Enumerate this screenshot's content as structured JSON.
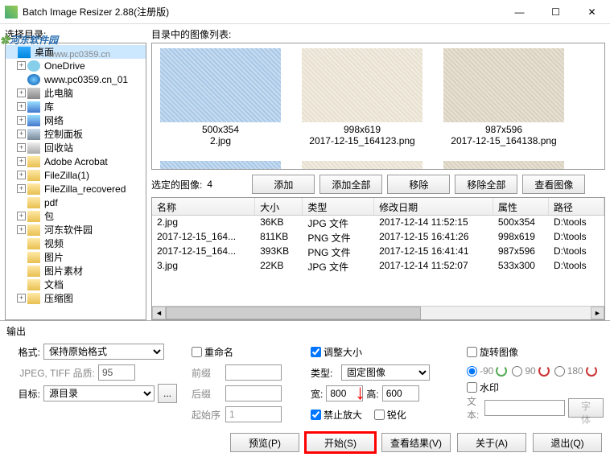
{
  "window": {
    "title": "Batch Image Resizer 2.88(注册版)",
    "min": "—",
    "max": "☐",
    "close": "✕"
  },
  "watermark": {
    "brand": "河东软件园",
    "url": "www.pc0359.cn"
  },
  "tree": {
    "label": "选择目录:",
    "items": [
      {
        "depth": 0,
        "exp": "",
        "ico": "desktop",
        "text": "桌面",
        "sel": true
      },
      {
        "depth": 1,
        "exp": "+",
        "ico": "cloud",
        "text": "OneDrive"
      },
      {
        "depth": 1,
        "exp": "",
        "ico": "globe",
        "text": "www.pc0359.cn_01"
      },
      {
        "depth": 1,
        "exp": "+",
        "ico": "pc",
        "text": "此电脑"
      },
      {
        "depth": 1,
        "exp": "+",
        "ico": "lib",
        "text": "库"
      },
      {
        "depth": 1,
        "exp": "+",
        "ico": "net",
        "text": "网络"
      },
      {
        "depth": 1,
        "exp": "+",
        "ico": "panel",
        "text": "控制面板"
      },
      {
        "depth": 1,
        "exp": "+",
        "ico": "trash",
        "text": "回收站"
      },
      {
        "depth": 1,
        "exp": "+",
        "ico": "folder",
        "text": "Adobe Acrobat"
      },
      {
        "depth": 1,
        "exp": "+",
        "ico": "folder",
        "text": "FileZilla(1)"
      },
      {
        "depth": 1,
        "exp": "+",
        "ico": "folder",
        "text": "FileZilla_recovered"
      },
      {
        "depth": 1,
        "exp": "",
        "ico": "folder",
        "text": "pdf"
      },
      {
        "depth": 1,
        "exp": "+",
        "ico": "folder",
        "text": "包"
      },
      {
        "depth": 1,
        "exp": "+",
        "ico": "folder",
        "text": "河东软件园"
      },
      {
        "depth": 1,
        "exp": "",
        "ico": "folder",
        "text": "视频"
      },
      {
        "depth": 1,
        "exp": "",
        "ico": "folder",
        "text": "图片"
      },
      {
        "depth": 1,
        "exp": "",
        "ico": "folder",
        "text": "图片素材"
      },
      {
        "depth": 1,
        "exp": "",
        "ico": "folder",
        "text": "文档"
      },
      {
        "depth": 1,
        "exp": "+",
        "ico": "folder",
        "text": "压缩图"
      }
    ]
  },
  "thumbs": {
    "label": "目录中的图像列表:",
    "items": [
      {
        "dims": "500x354",
        "fn": "2.jpg",
        "cls": ""
      },
      {
        "dims": "998x619",
        "fn": "2017-12-15_164123.png",
        "cls": "i2"
      },
      {
        "dims": "987x596",
        "fn": "2017-12-15_164138.png",
        "cls": "i3"
      }
    ]
  },
  "selbar": {
    "label": "选定的图像:",
    "count": "4",
    "add": "添加",
    "addall": "添加全部",
    "remove": "移除",
    "removeall": "移除全部",
    "view": "查看图像"
  },
  "list": {
    "cols": {
      "name": "名称",
      "size": "大小",
      "type": "类型",
      "date": "修改日期",
      "attr": "属性",
      "path": "路径"
    },
    "rows": [
      {
        "name": "2.jpg",
        "size": "36KB",
        "type": "JPG 文件",
        "date": "2017-12-14 11:52:15",
        "attr": "500x354",
        "path": "D:\\tools"
      },
      {
        "name": "2017-12-15_164...",
        "size": "811KB",
        "type": "PNG 文件",
        "date": "2017-12-15 16:41:26",
        "attr": "998x619",
        "path": "D:\\tools"
      },
      {
        "name": "2017-12-15_164...",
        "size": "393KB",
        "type": "PNG 文件",
        "date": "2017-12-15 16:41:41",
        "attr": "987x596",
        "path": "D:\\tools"
      },
      {
        "name": "3.jpg",
        "size": "22KB",
        "type": "JPG 文件",
        "date": "2017-12-14 11:52:07",
        "attr": "533x300",
        "path": "D:\\tools"
      }
    ]
  },
  "output": {
    "title": "输出",
    "format_lbl": "格式:",
    "format_val": "保持原始格式",
    "quality_lbl": "JPEG, TIFF 品质:",
    "quality_val": "95",
    "dest_lbl": "目标:",
    "dest_val": "源目录",
    "browse": "...",
    "rename_chk": "重命名",
    "prefix_lbl": "前缀",
    "suffix_lbl": "后缀",
    "start_lbl": "起始序",
    "start_val": "1",
    "resize_chk": "调整大小",
    "type_lbl": "类型:",
    "type_val": "固定图像",
    "width_lbl": "宽:",
    "width_val": "800",
    "height_lbl": "高:",
    "height_val": "600",
    "noenlarge": "禁止放大",
    "sharpen": "锐化",
    "rotate_chk": "旋转图像",
    "rot_n90": "-90",
    "rot_p90": "90",
    "rot_180": "180",
    "watermark_chk": "水印",
    "wm_text_lbl": "文本:",
    "wm_font": "字体"
  },
  "buttons": {
    "preview": "预览(P)",
    "start": "开始(S)",
    "results": "查看结果(V)",
    "about": "关于(A)",
    "exit": "退出(Q)"
  }
}
